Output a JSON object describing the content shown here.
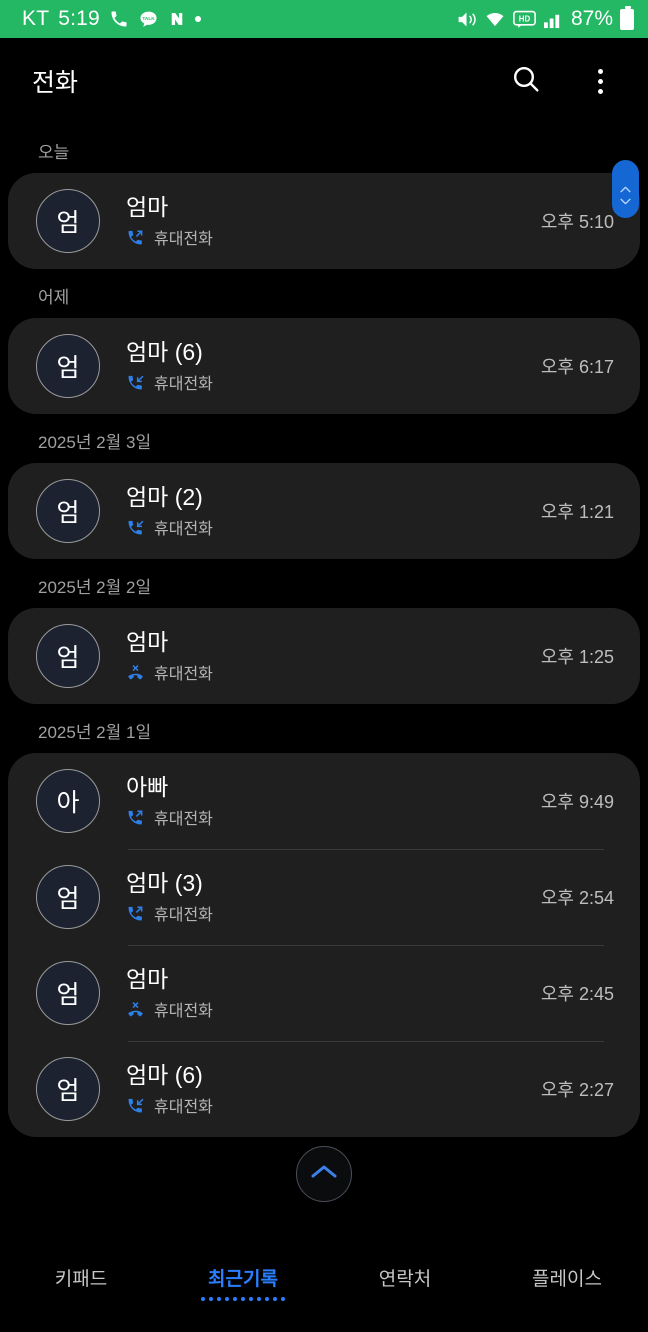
{
  "status_bar": {
    "carrier": "KT",
    "time": "5:19",
    "battery_percent": "87%",
    "left_icons": [
      "phone-call-icon",
      "kakaotalk-icon",
      "naver-icon",
      "dot-icon"
    ],
    "right_icons": [
      "mute-icon",
      "wifi-icon",
      "hd-volte-icon",
      "signal-bars-icon",
      "battery-icon"
    ],
    "background_color": "#25b864"
  },
  "app_bar": {
    "title": "전화",
    "search_label": "search-icon",
    "more_label": "more-options-icon"
  },
  "scroll_pill": {
    "up": "chevron-up-icon",
    "down": "chevron-down-icon",
    "color": "#1567d3"
  },
  "scroll_top_button": {
    "label": "chevron-up-icon"
  },
  "groups": [
    {
      "date": "오늘",
      "rows": [
        {
          "initial": "엄",
          "name": "엄마",
          "type": "outgoing",
          "line": "휴대전화",
          "time": "오후 5:10"
        }
      ]
    },
    {
      "date": "어제",
      "rows": [
        {
          "initial": "엄",
          "name": "엄마 (6)",
          "type": "incoming",
          "line": "휴대전화",
          "time": "오후 6:17"
        }
      ]
    },
    {
      "date": "2025년 2월 3일",
      "rows": [
        {
          "initial": "엄",
          "name": "엄마 (2)",
          "type": "incoming",
          "line": "휴대전화",
          "time": "오후 1:21"
        }
      ]
    },
    {
      "date": "2025년 2월 2일",
      "rows": [
        {
          "initial": "엄",
          "name": "엄마",
          "type": "declined",
          "line": "휴대전화",
          "time": "오후 1:25"
        }
      ]
    },
    {
      "date": "2025년 2월 1일",
      "rows": [
        {
          "initial": "아",
          "name": "아빠",
          "type": "outgoing",
          "line": "휴대전화",
          "time": "오후 9:49"
        },
        {
          "initial": "엄",
          "name": "엄마 (3)",
          "type": "outgoing",
          "line": "휴대전화",
          "time": "오후 2:54"
        },
        {
          "initial": "엄",
          "name": "엄마",
          "type": "declined",
          "line": "휴대전화",
          "time": "오후 2:45"
        },
        {
          "initial": "엄",
          "name": "엄마 (6)",
          "type": "incoming",
          "line": "휴대전화",
          "time": "오후 2:27"
        }
      ]
    }
  ],
  "bottom_nav": {
    "active_index": 1,
    "items": [
      {
        "label": "키패드"
      },
      {
        "label": "최근기록"
      },
      {
        "label": "연락처"
      },
      {
        "label": "플레이스"
      }
    ],
    "active_color": "#2a7fff"
  }
}
